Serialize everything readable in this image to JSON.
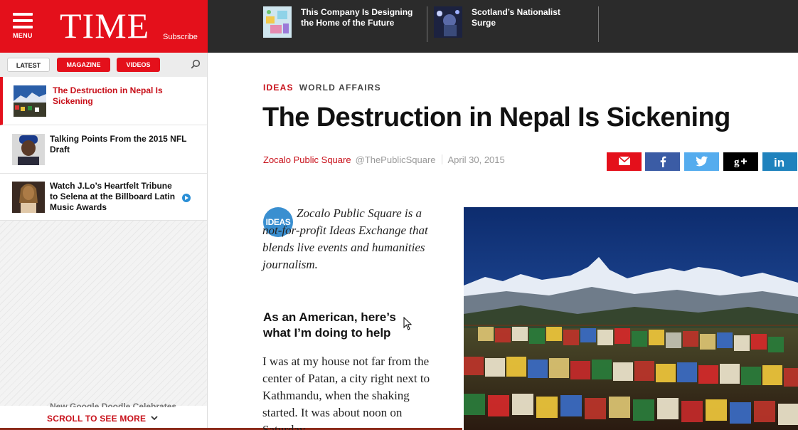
{
  "masthead": {
    "menu_label": "MENU",
    "logo": "TIME",
    "subscribe": "Subscribe"
  },
  "promos": [
    {
      "title": "This Company Is Designing the Home of the Future"
    },
    {
      "title": "Scotland’s Nationalist Surge"
    }
  ],
  "nav": {
    "tabs": [
      "LATEST",
      "MAGAZINE",
      "VIDEOS"
    ],
    "items": [
      {
        "title": "The Destruction in Nepal Is Sickening",
        "active": true
      },
      {
        "title": "Talking Points From the 2015 NFL Draft"
      },
      {
        "title": "Watch J.Lo’s Heartfelt Tribune to Selena at the Billboard Latin Music Awards",
        "video": true
      }
    ],
    "partial_item": "New Google Doodle Celebrates",
    "scroll_more": "SCROLL TO SEE MORE"
  },
  "article": {
    "section": "IDEAS",
    "category": "WORLD AFFAIRS",
    "headline": "The Destruction in Nepal Is Sickening",
    "author": "Zocalo Public Square",
    "handle": "@ThePublicSquare",
    "date": "April 30, 2015",
    "badge": "IDEAS",
    "intro": "Zocalo Public Square is a not-for-profit Ideas Exchange that blends live events and humanities journalism.",
    "subhead": "As an American, here’s what I’m doing to help",
    "body": "I was at my house not far from the center of Patan, a city right next to Kathmandu, when the shaking started. It was about noon on Saturday"
  },
  "share": {
    "colors": {
      "email": "#e4101b",
      "facebook": "#3b5ca5",
      "twitter": "#55acee",
      "googleplus": "#000000",
      "linkedin": "#1f82bd"
    }
  },
  "colors": {
    "brand": "#e4101b",
    "dark_bar": "#2b2b2b",
    "ideas_badge": "#3a8fd0"
  }
}
